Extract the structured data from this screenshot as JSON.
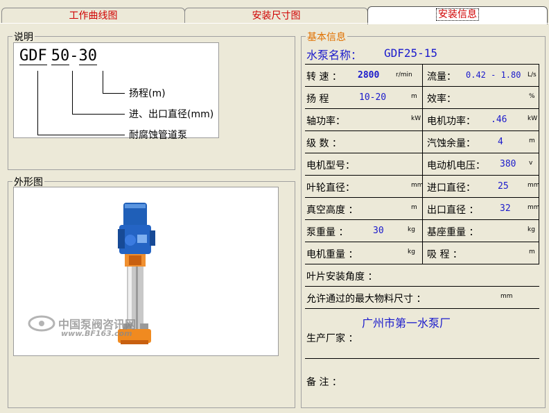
{
  "tabs": [
    {
      "label": "工作曲线图",
      "active": false
    },
    {
      "label": "安装尺寸图",
      "active": false
    },
    {
      "label": "安装信息",
      "active": true
    }
  ],
  "legend": {
    "title": "说明",
    "code_part1": "GDF",
    "code_part2": "50",
    "code_dash": "-",
    "code_part3": "30",
    "label1": "扬程(m)",
    "label2": "进、出口直径(mm)",
    "label3": "耐腐蚀管道泵"
  },
  "appearance": {
    "title": "外形图",
    "watermark_cn": "中国泵阀咨讯网",
    "watermark_url": "www.BF163.com"
  },
  "basic": {
    "title": "基本信息",
    "pump_name_label": "水泵名称：",
    "pump_name_value": "GDF25-15",
    "speed_label": "转  速 ：",
    "speed_value": "2800",
    "speed_unit": "r/min",
    "flow_label": "流量：",
    "flow_value": "0.42 - 1.80",
    "flow_unit": "L/s",
    "head_label": "扬  程",
    "head_value": "10-20",
    "head_unit": "m",
    "eff_label": "效率：",
    "eff_unit": "%",
    "shaft_label": "轴功率：",
    "shaft_unit": "kW",
    "motor_power_label": "电机功率：",
    "motor_power_value": ".46",
    "motor_power_unit": "kW",
    "stage_label": "级  数 ：",
    "npsh_label": "汽蚀余量：",
    "npsh_value": "4",
    "npsh_unit": "m",
    "motor_model_label": "电机型号：",
    "voltage_label": "电动机电压：",
    "voltage_value": "380",
    "voltage_unit": "v",
    "impeller_label": "叶轮直径：",
    "impeller_unit": "mm",
    "inlet_label": "进口直径：",
    "inlet_value": "25",
    "inlet_unit": "mm",
    "vacuum_label": "真空高度 ：",
    "vacuum_unit": "m",
    "outlet_label": "出口直径 ：",
    "outlet_value": "32",
    "outlet_unit": "mm",
    "pump_weight_label": "泵重量 ：",
    "pump_weight_value": "30",
    "pump_weight_unit": "kg",
    "base_weight_label": "基座重量 ：",
    "base_weight_unit": "kg",
    "motor_weight_label": "电机重量 ：",
    "motor_weight_unit": "kg",
    "suction_label": "吸  程 ：",
    "suction_unit": "m",
    "blade_angle_label": "叶片安装角度 ：",
    "max_size_label": "允许通过的最大物料尺寸 ：",
    "max_size_unit": "mm",
    "manufacturer_label": "生产厂家 ：",
    "manufacturer_value": "广州市第一水泵厂",
    "remark_label": "备    注 ："
  },
  "colors": {
    "tab_text": "#d00000",
    "value_blue": "#1a1acc",
    "panel_bg": "#ece9d8",
    "section_title": "#e07000"
  }
}
